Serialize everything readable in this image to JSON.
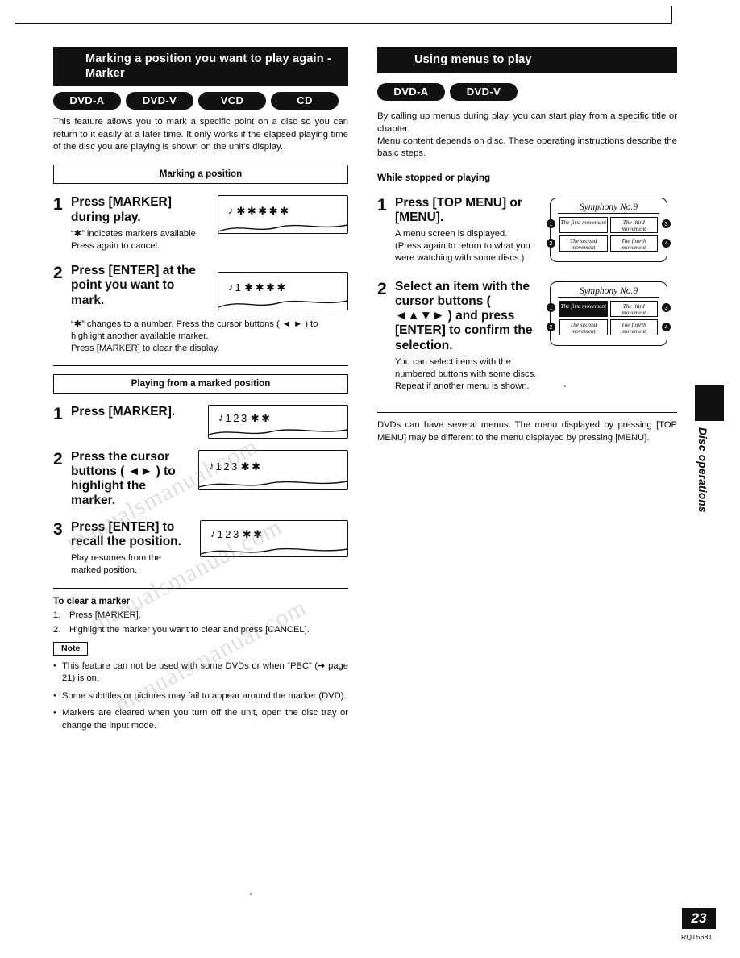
{
  "page": {
    "number": "23",
    "doc_code": "RQT5681",
    "side_tab_label": "Disc operations",
    "watermark": [
      "manualsmanual.com",
      "manualsmanual.com",
      "manualsmanual.com"
    ]
  },
  "left": {
    "heading": "Marking a position you want to play again - Marker",
    "disc_badges": [
      "DVD-A",
      "DVD-V",
      "VCD",
      "CD"
    ],
    "intro": "This feature allows you to mark a specific point on a disc so you can return to it easily at a later time. It only works if the elapsed playing time of the disc you are playing is shown on the unit's display.",
    "sub1": "Marking a position",
    "steps1": [
      {
        "num": "1",
        "title": "Press [MARKER] during play.",
        "sub": "“✱” indicates markers available.\nPress again to cancel.",
        "display": {
          "icon": "♪",
          "digits": "",
          "stars": "✱✱✱✱✱"
        }
      },
      {
        "num": "2",
        "title": "Press [ENTER] at the point you want to mark.",
        "sub": "“✱” changes to a number. Press the cursor buttons ( ◄ ► ) to highlight another available marker.\nPress [MARKER] to clear the display.",
        "display": {
          "icon": "♪",
          "digits": "1",
          "stars": "✱✱✱✱"
        }
      }
    ],
    "sub2": "Playing from a marked position",
    "steps2": [
      {
        "num": "1",
        "title": "Press [MARKER].",
        "sub": "",
        "display": {
          "icon": "♪",
          "digits": "123",
          "stars": "✱✱"
        }
      },
      {
        "num": "2",
        "title": "Press the cursor buttons ( ◄► ) to highlight the marker.",
        "sub": "",
        "display": {
          "icon": "♪",
          "digits": "123",
          "stars": "✱✱"
        }
      },
      {
        "num": "3",
        "title": "Press [ENTER] to recall the position.",
        "sub": "Play resumes from the marked position.",
        "display": {
          "icon": "♪",
          "digits": "123",
          "stars": "✱✱"
        }
      }
    ],
    "clear_head": "To clear a marker",
    "clear_steps": [
      {
        "n": "1.",
        "text": "Press [MARKER]."
      },
      {
        "n": "2.",
        "text": "Highlight the marker you want to clear and press [CANCEL]."
      }
    ],
    "note_label": "Note",
    "notes": [
      "This feature can not be used with some DVDs or when “PBC” (➜ page 21) is on.",
      "Some subtitles or pictures may fail to appear around the marker (DVD).",
      "Markers are cleared when you turn off the unit, open the disc tray or change the input mode."
    ]
  },
  "right": {
    "heading": "Using menus to play",
    "disc_badges": [
      "DVD-A",
      "DVD-V"
    ],
    "intro": "By calling up menus during play, you can start play from a specific title or chapter.\nMenu content depends on disc. These operating instructions describe the basic steps.",
    "condition": "While stopped or playing",
    "steps": [
      {
        "num": "1",
        "title": "Press [TOP MENU] or [MENU].",
        "sub": "A menu screen is displayed.\n(Press again to return to what you were watching with some discs.)",
        "screen": {
          "title": "Symphony No.9",
          "cells": [
            "The first movement",
            "The third movement",
            "The second movement",
            "The fourth movement"
          ],
          "selected": -1,
          "dots": [
            "1",
            "2",
            "3",
            "4"
          ]
        }
      },
      {
        "num": "2",
        "title": "Select an item with the cursor buttons ( ◄▲▼► ) and press [ENTER] to confirm the selection.",
        "sub": "You can select items with the numbered buttons with some discs.\nRepeat if another menu is shown.",
        "screen": {
          "title": "Symphony No.9",
          "cells": [
            "The first movement",
            "The third movement",
            "The second movement",
            "The fourth movement"
          ],
          "selected": 0,
          "dots": [
            "1",
            "2",
            "3",
            "4"
          ]
        }
      }
    ],
    "footnote": "DVDs can have several menus. The menu displayed by pressing [TOP MENU] may be different to the menu displayed by pressing [MENU]."
  }
}
